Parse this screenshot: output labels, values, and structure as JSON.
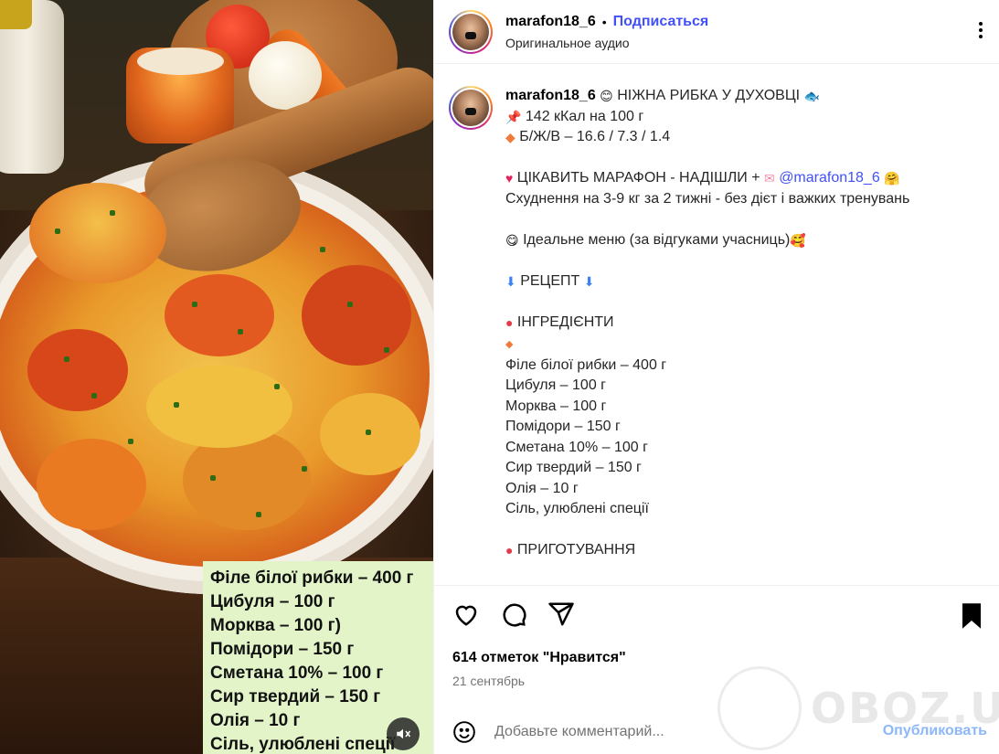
{
  "post": {
    "username": "marafon18_6",
    "follow_label": "Подписаться",
    "audio_label": "Оригинальное аудио"
  },
  "media": {
    "overlay_lines": [
      "Філе білої рибки – 400 г",
      "Цибуля – 100 г",
      "Морква – 100 г)",
      "Помідори – 150 г",
      "Сметана 10% – 100 г",
      "Сир твердий – 150 г",
      "Олія – 10 г",
      "Сіль, улюблені спеції"
    ]
  },
  "caption": {
    "username": "marafon18_6",
    "title": "НІЖНА РИБКА У ДУХОВЦІ",
    "kcal": "142 кКал на 100 г",
    "bju": "Б/Ж/В – 16.6 / 7.3 / 1.4",
    "marathon_text": "ЦІКАВИТЬ МАРАФОН - НАДІШЛИ +",
    "mention": "@marafon18_6",
    "promo": "Схуднення на 3-9 кг за 2 тижні - без дієт і важких тренувань",
    "menu": "Ідеальне меню (за відгуками учасниць)",
    "recipe": "РЕЦЕПТ",
    "ingredients_header": "ІНГРЕДІЄНТИ",
    "ingredients": [
      "Філе білої рибки – 400 г",
      "Цибуля – 100 г",
      "Морква – 100 г",
      "Помідори – 150 г",
      "Сметана 10% – 100 г",
      "Сир твердий – 150 г",
      "Олія – 10 г",
      "Сіль, улюблені спеції"
    ],
    "cooking_header": "ПРИГОТУВАННЯ"
  },
  "actions": {
    "likes": "614 отметок \"Нравится\"",
    "date": "21 сентябрь",
    "comment_placeholder": "Добавьте комментарий...",
    "publish_label": "Опубликовать"
  },
  "watermark": "OBOZ.UA",
  "colors": {
    "link": "#4150f7",
    "publish": "#8db7fb",
    "overlay_bg": "#e2f4c8"
  }
}
